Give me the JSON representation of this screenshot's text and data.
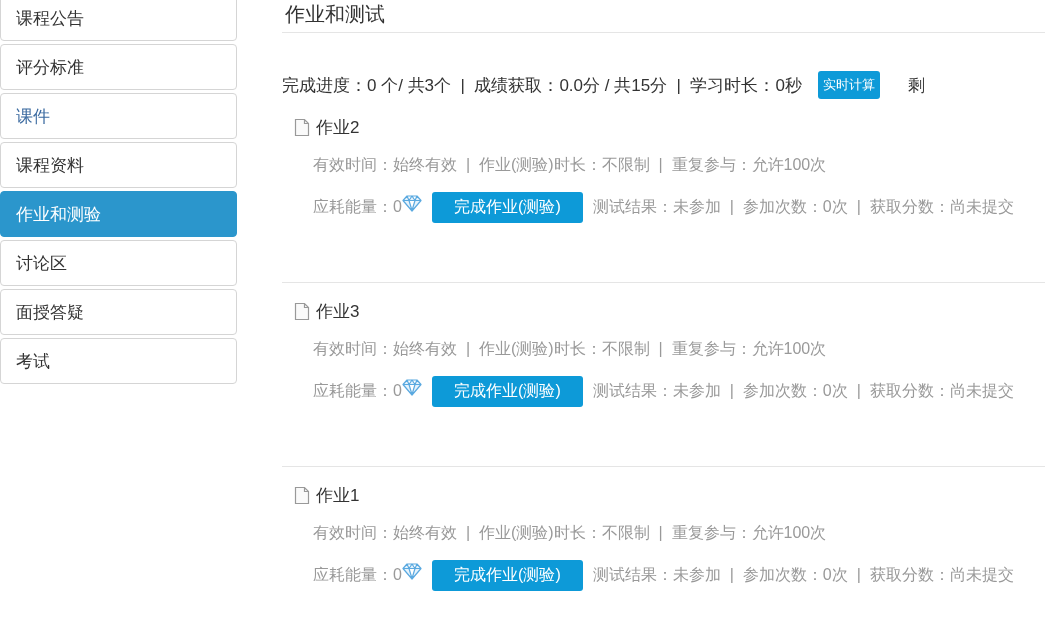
{
  "sidebar": {
    "items": [
      {
        "label": "课程公告",
        "selected": false,
        "visited": false
      },
      {
        "label": "评分标准",
        "selected": false,
        "visited": false
      },
      {
        "label": "课件",
        "selected": false,
        "visited": true
      },
      {
        "label": "课程资料",
        "selected": false,
        "visited": false
      },
      {
        "label": "作业和测验",
        "selected": true,
        "visited": false
      },
      {
        "label": "讨论区",
        "selected": false,
        "visited": false
      },
      {
        "label": "面授答疑",
        "selected": false,
        "visited": false
      },
      {
        "label": "考试",
        "selected": false,
        "visited": false
      }
    ]
  },
  "page_title": "作业和测试",
  "progress": {
    "summary": "完成进度：0 个/ 共3个  |  成绩获取：0.0分 / 共15分  |  学习时长：0秒",
    "badge": "实时计算",
    "remaining": "剩"
  },
  "assignments": [
    {
      "title": "作业2",
      "info": "有效时间：始终有效  |  作业(测验)时长：不限制  |  重复参与：允许100次",
      "energy": "应耗能量：0",
      "button": "完成作业(测验)",
      "result": "测试结果：未参加  |  参加次数：0次  |  获取分数：尚未提交"
    },
    {
      "title": "作业3",
      "info": "有效时间：始终有效  |  作业(测验)时长：不限制  |  重复参与：允许100次",
      "energy": "应耗能量：0",
      "button": "完成作业(测验)",
      "result": "测试结果：未参加  |  参加次数：0次  |  获取分数：尚未提交"
    },
    {
      "title": "作业1",
      "info": "有效时间：始终有效  |  作业(测验)时长：不限制  |  重复参与：允许100次",
      "energy": "应耗能量：0",
      "button": "完成作业(测验)",
      "result": "测试结果：未参加  |  参加次数：0次  |  获取分数：尚未提交"
    }
  ]
}
